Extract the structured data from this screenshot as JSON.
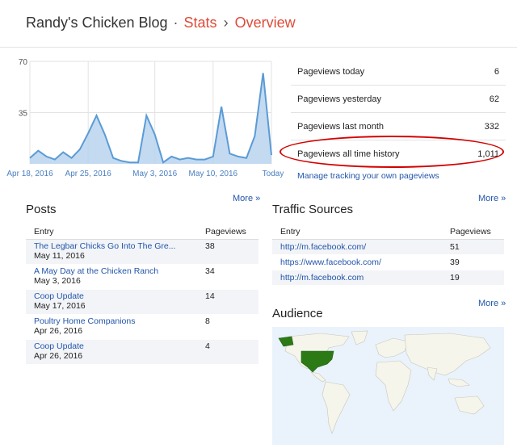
{
  "header": {
    "blog_title": "Randy's Chicken Blog",
    "separator": "·",
    "stats_label": "Stats",
    "chevron": "›",
    "overview_label": "Overview"
  },
  "chart_data": {
    "type": "area",
    "ylim": [
      0,
      70
    ],
    "yticks": [
      35,
      70
    ],
    "xtick_labels": [
      "Apr 18, 2016",
      "Apr 25, 2016",
      "May 3, 2016",
      "May 10, 2016",
      "Today"
    ],
    "xtick_index": [
      0,
      7,
      15,
      22,
      29
    ],
    "values": [
      4,
      9,
      5,
      3,
      8,
      4,
      10,
      21,
      33,
      20,
      4,
      2,
      1,
      1,
      33,
      20,
      1,
      5,
      3,
      4,
      3,
      3,
      5,
      39,
      7,
      5,
      4,
      19,
      62,
      6
    ],
    "colors": {
      "line": "#5b9bd5",
      "fill": "#b9d3ee",
      "grid": "#e3e3e3"
    }
  },
  "stats": [
    {
      "label": "Pageviews today",
      "value": "6"
    },
    {
      "label": "Pageviews yesterday",
      "value": "62"
    },
    {
      "label": "Pageviews last month",
      "value": "332"
    },
    {
      "label": "Pageviews all time history",
      "value": "1,011"
    }
  ],
  "manage_link": "Manage tracking your own pageviews",
  "more_label": "More »",
  "posts": {
    "title": "Posts",
    "col_entry": "Entry",
    "col_views": "Pageviews",
    "rows": [
      {
        "entry": "The Legbar Chicks Go Into The Gre...",
        "date": "May 11, 2016",
        "views": "38"
      },
      {
        "entry": "A May Day at the Chicken Ranch",
        "date": "May 3, 2016",
        "views": "34"
      },
      {
        "entry": "Coop Update",
        "date": "May 17, 2016",
        "views": "14"
      },
      {
        "entry": "Poultry Home Companions",
        "date": "Apr 26, 2016",
        "views": "8"
      },
      {
        "entry": "Coop Update",
        "date": "Apr 26, 2016",
        "views": "4"
      }
    ]
  },
  "traffic": {
    "title": "Traffic Sources",
    "col_entry": "Entry",
    "col_views": "Pageviews",
    "rows": [
      {
        "entry": "http://m.facebook.com/",
        "views": "51"
      },
      {
        "entry": "https://www.facebook.com/",
        "views": "39"
      },
      {
        "entry": "http://m.facebook.com",
        "views": "19"
      }
    ]
  },
  "audience": {
    "title": "Audience",
    "colors": {
      "ocean": "#eaf2fb",
      "land": "#f5f5ec",
      "highlight": "#2b7a16",
      "border": "#c8c8b8"
    }
  }
}
